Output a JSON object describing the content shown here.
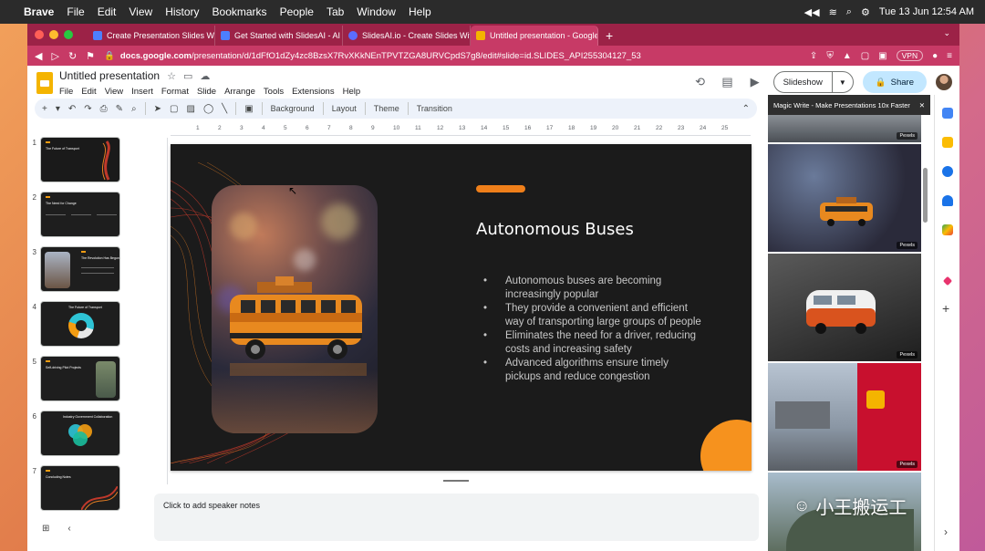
{
  "menubar": {
    "app": "Brave",
    "items": [
      "File",
      "Edit",
      "View",
      "History",
      "Bookmarks",
      "People",
      "Tab",
      "Window",
      "Help"
    ],
    "clock": "Tue 13 Jun  12:54 AM"
  },
  "browser": {
    "tabs": [
      {
        "label": "Create Presentation Slides With AI",
        "favicon_color": "#4d7fff"
      },
      {
        "label": "Get Started with SlidesAI - AI Power",
        "favicon_color": "#4d7fff"
      },
      {
        "label": "SlidesAI.io - Create Slides With AI",
        "favicon_color": "#5b6cff"
      },
      {
        "label": "Untitled presentation - Google",
        "favicon_color": "#f4b400"
      }
    ],
    "url_host": "docs.google.com",
    "url_path": "/presentation/d/1dFfO1dZy4zc8BzsX7RvXKkNEnTPVTZGA8URVCpdS7g8/edit#slide=id.SLIDES_API255304127_53",
    "vpn_label": "VPN"
  },
  "docs": {
    "title": "Untitled presentation",
    "menu": [
      "File",
      "Edit",
      "View",
      "Insert",
      "Format",
      "Slide",
      "Arrange",
      "Tools",
      "Extensions",
      "Help"
    ],
    "slideshow_label": "Slideshow",
    "share_label": "Share",
    "toolbar": {
      "background": "Background",
      "layout": "Layout",
      "theme": "Theme",
      "transition": "Transition"
    }
  },
  "ruler_ticks": [
    "1",
    "2",
    "3",
    "4",
    "5",
    "6",
    "7",
    "8",
    "9",
    "10",
    "11",
    "12",
    "13",
    "14",
    "15",
    "16",
    "17",
    "18",
    "19",
    "20",
    "21",
    "22",
    "23",
    "24",
    "25"
  ],
  "filmstrip": {
    "slides": [
      {
        "number": "1",
        "title": "The Future of Transport"
      },
      {
        "number": "2",
        "title": "The Need for Change"
      },
      {
        "number": "3",
        "title": "The Revolution Has Begun"
      },
      {
        "number": "4",
        "title": "The Future of Transport"
      },
      {
        "number": "5",
        "title": "Self-driving Pilot Projects"
      },
      {
        "number": "6",
        "title": "Industry Government Collaboration"
      },
      {
        "number": "7",
        "title": "Concluding Notes"
      }
    ]
  },
  "slide": {
    "title": "Autonomous Buses",
    "bullets": [
      "Autonomous buses are becoming increasingly popular",
      "They provide a convenient and efficient way of transporting large groups of people",
      "Eliminates the need for a driver, reducing costs and increasing safety",
      "Advanced algorithms ensure timely pickups and reduce congestion"
    ]
  },
  "speaker_notes_placeholder": "Click to add speaker notes",
  "side_panel": {
    "title": "Magic Write - Make Presentations 10x Faster",
    "image_credit": "Pexels"
  },
  "watermark": "小王搬运工"
}
